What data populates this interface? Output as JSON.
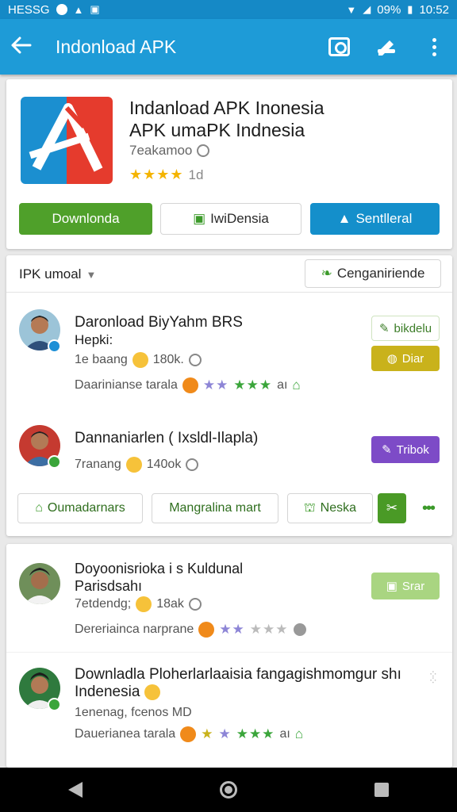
{
  "status_bar": {
    "left_text": "HESSG",
    "battery": "09%",
    "time": "10:52"
  },
  "app_bar": {
    "title": "Indonload APK"
  },
  "app_card": {
    "name_line1": "Indanload APK Inonesia",
    "name_line2": "APK umaPK Indnesia",
    "developer": "7eakamoo",
    "stars": "★★★★",
    "rating_count": "1d",
    "buttons": {
      "download": "Downlonda",
      "indonesia": "IwiDensia",
      "share": "Sentlleral"
    }
  },
  "section": {
    "header": "IPK umoal",
    "action": "Cenganiriende",
    "items": [
      {
        "title_line1": "Daronload BiyYahm BRS",
        "title_line2": "Hepki:",
        "meta": "1e baang",
        "meta_count": "180k.",
        "line": "Daarinianse tarala",
        "stars_a": "★★",
        "stars_b": "★★★",
        "stars_suffix": "aı",
        "action_top": "bikdelu",
        "action_bottom": "Diar"
      },
      {
        "title_line1": "Dannaniarlen ( Ixsldl-Ilapla)",
        "meta": "7ranang",
        "meta_count": "140ok",
        "action": "Tribok"
      }
    ],
    "chips": [
      "Oumadarnars",
      "Mangralina mart",
      "Neska"
    ]
  },
  "section2": {
    "items": [
      {
        "title_line1": "Doyoonisrioka i s Kuldunal",
        "title_line2": "Parisdsahı",
        "meta": "7etdendg;",
        "meta_count": "18ak",
        "line": "Dereriainca narprane",
        "stars_a": "★★",
        "stars_b": "★★★",
        "action": "Srar"
      },
      {
        "title_line1": "Downladla Ploherlarlaaisia fangagishmomgur shı",
        "title_line2": "Indenesia",
        "meta": "1enenag, fcenos MD",
        "line": "Dauerianea tarala",
        "stars_a": "★",
        "stars_b": "★",
        "stars_c": "★★★",
        "stars_suffix": "aı"
      }
    ]
  }
}
